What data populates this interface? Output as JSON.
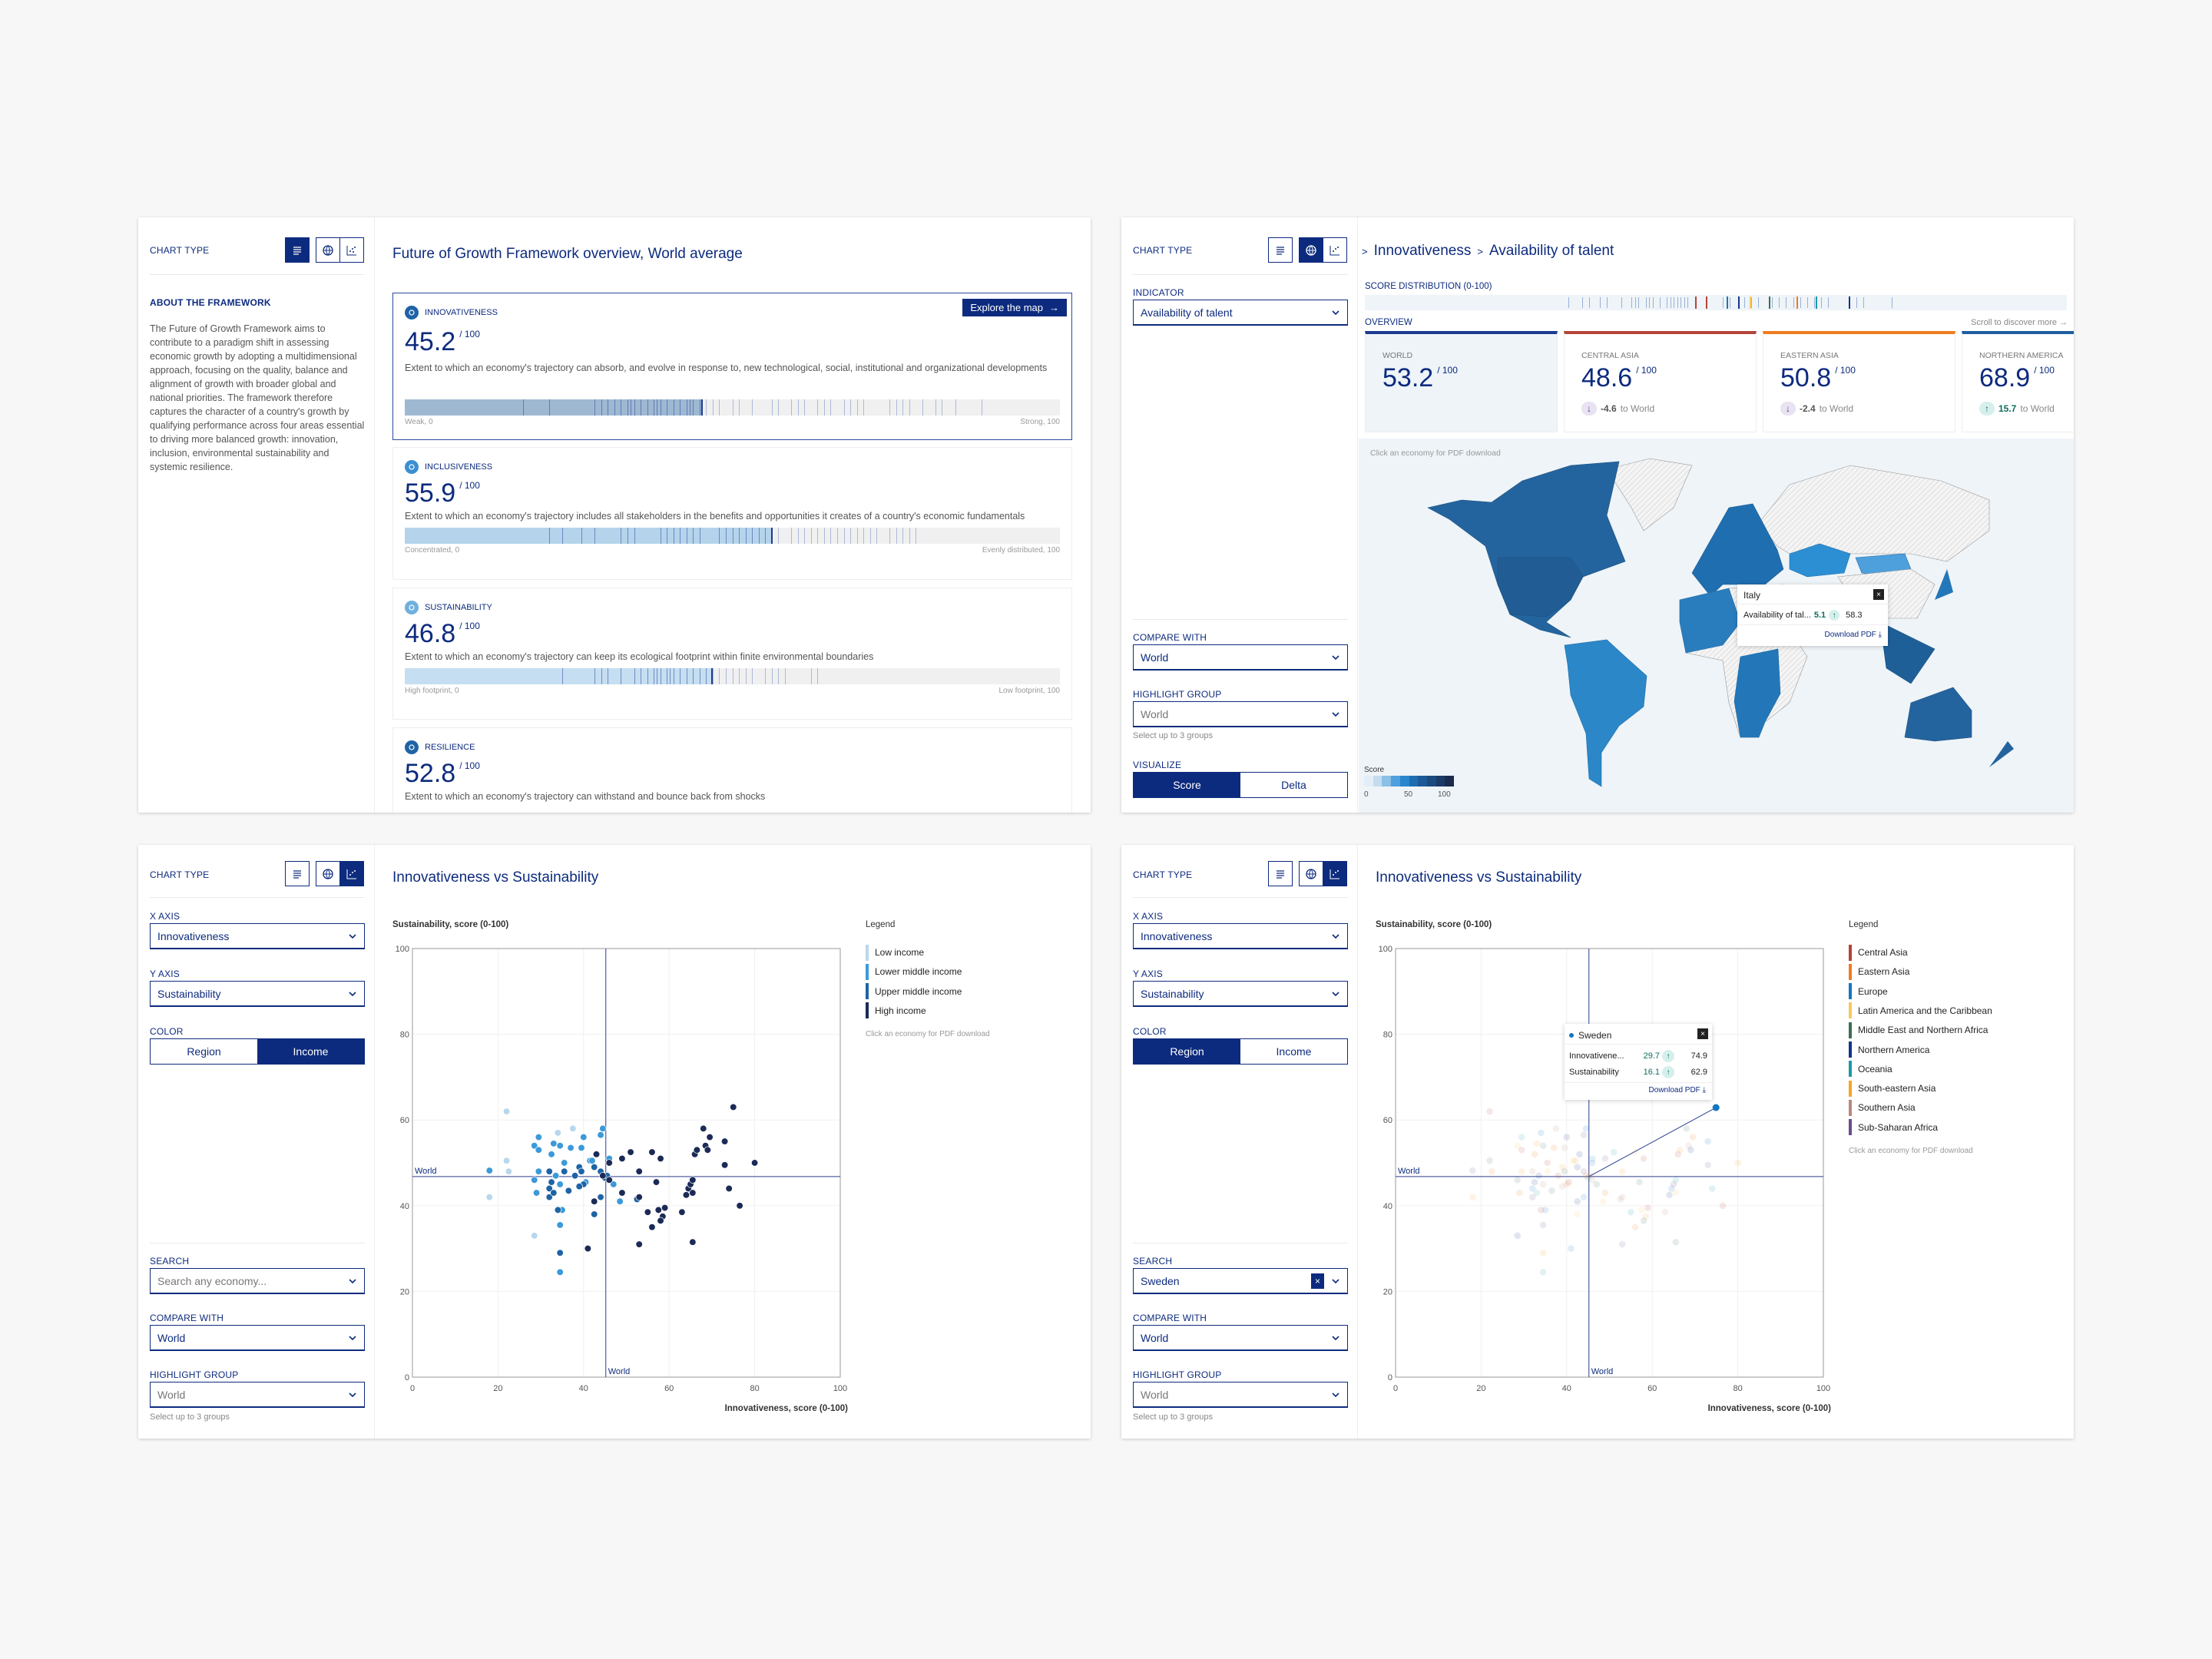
{
  "common": {
    "chart_type_label": "CHART TYPE",
    "per100": "/ 100",
    "compare_with_label": "COMPARE WITH",
    "compare_with_value": "World",
    "highlight_group_label": "HIGHLIGHT GROUP",
    "highlight_group_value": "World",
    "highlight_hint": "Select up to 3 groups",
    "click_hint": "Click an economy for PDF download"
  },
  "overview_panel": {
    "about_label": "ABOUT THE FRAMEWORK",
    "about_text": "The Future of Growth Framework aims to contribute to a paradigm shift in assessing economic growth by adopting a multidimensional approach, focusing on the quality, balance and alignment of growth with broader global and national priorities. The framework therefore captures the character of a country's growth by qualifying performance across four areas essential to driving more balanced growth: innovation, inclusion, environmental sustainability and systemic resilience.",
    "title": "Future of Growth Framework overview, World average",
    "explore_button": "Explore the map",
    "pillars": [
      {
        "name": "INNOVATIVENESS",
        "score": "45.2",
        "value": 45.2,
        "icon": "lightbulb-icon",
        "color": "#1e64a5",
        "fill": "#9fb8d2",
        "desc": "Extent to which an economy's trajectory can absorb, and evolve in response to, new technological, social, institutional and organizational developments",
        "low": "Weak, 0",
        "high": "Strong, 100",
        "ticks": [
          18,
          22,
          29,
          30,
          31,
          32,
          33,
          34,
          34.5,
          35,
          36,
          37,
          38,
          38.5,
          39,
          40,
          41,
          42,
          43,
          43.5,
          44,
          45,
          46,
          47,
          48,
          50,
          51,
          53,
          56,
          57,
          59,
          60,
          61,
          63,
          64,
          65,
          67,
          68,
          69,
          70,
          74,
          75,
          76,
          77,
          79,
          81,
          82,
          84,
          88
        ]
      },
      {
        "name": "INCLUSIVENESS",
        "score": "55.9",
        "value": 55.9,
        "icon": "network-icon",
        "color": "#3b8fd0",
        "fill": "#b5d4ec",
        "desc": "Extent to which an economy's trajectory includes all stakeholders in the benefits and opportunities it creates of a country's economic fundamentals",
        "low": "Concentrated, 0",
        "high": "Evenly distributed, 100",
        "ticks": [
          22,
          24,
          27,
          29,
          33,
          34,
          35,
          39,
          40,
          41,
          42,
          43,
          44,
          45,
          48,
          49,
          50,
          51,
          52,
          53,
          54,
          55,
          56,
          57,
          59,
          60,
          61,
          62,
          63,
          64,
          65,
          66,
          67,
          68,
          69,
          70,
          71,
          72,
          74,
          75,
          76,
          77,
          78
        ]
      },
      {
        "name": "SUSTAINABILITY",
        "score": "46.8",
        "value": 46.8,
        "icon": "globe-leaf-icon",
        "color": "#6fb0dd",
        "fill": "#c5def1",
        "desc": "Extent to which an economy's trajectory can keep its ecological footprint within finite environmental boundaries",
        "low": "High footprint, 0",
        "high": "Low footprint, 100",
        "ticks": [
          24,
          29,
          30,
          31,
          33,
          35,
          36,
          37,
          38,
          38.5,
          39,
          40,
          40.5,
          41,
          42,
          43,
          44,
          45,
          46,
          47,
          48,
          49,
          50,
          51,
          52,
          53,
          55,
          56,
          57,
          58,
          62,
          63
        ]
      },
      {
        "name": "RESILIENCE",
        "score": "52.8",
        "value": 52.8,
        "icon": "shield-arrows-icon",
        "color": "#1e64a5",
        "desc": "Extent to which an economy's trajectory can withstand and bounce back from shocks"
      }
    ]
  },
  "map_panel": {
    "breadcrumb": [
      "Innovativeness",
      "Availability of talent"
    ],
    "indicator_label": "INDICATOR",
    "indicator_value": "Availability of talent",
    "visualize_label": "VISUALIZE",
    "visualize_options": [
      "Score",
      "Delta"
    ],
    "visualize_selected": "Score",
    "distribution_label": "SCORE DISTRIBUTION (0-100)",
    "distribution_ticks": [
      29,
      31,
      32,
      33.5,
      34.5,
      36.5,
      38,
      38.5,
      39,
      40,
      40.5,
      41,
      42,
      43,
      43.5,
      44,
      44.5,
      45,
      45.5,
      46,
      51,
      52,
      54,
      55,
      56,
      58,
      59,
      60,
      61,
      62,
      63,
      64,
      65,
      66,
      69,
      70,
      71,
      75
    ],
    "distribution_highlights": [
      {
        "value": 47,
        "color": "#b5443a"
      },
      {
        "value": 48.6,
        "color": "#b5443a"
      },
      {
        "value": 51.5,
        "color": "#1277c2"
      },
      {
        "value": 53.2,
        "color": "#10358a"
      },
      {
        "value": 54.8,
        "color": "#f7c85c"
      },
      {
        "value": 57.5,
        "color": "#3f6e55"
      },
      {
        "value": 61.5,
        "color": "#f07c1e"
      },
      {
        "value": 64.2,
        "color": "#1b9aaa"
      },
      {
        "value": 68.9,
        "color": "#10358a"
      }
    ],
    "overview_label": "OVERVIEW",
    "scroll_hint": "Scroll to discover more →",
    "overview_cards": [
      {
        "name": "WORLD",
        "score": "53.2",
        "color": "#1d3b8f"
      },
      {
        "name": "CENTRAL ASIA",
        "score": "48.6",
        "color": "#b5443a",
        "delta": "-4.6",
        "direction": "down",
        "suffix": "to World"
      },
      {
        "name": "EASTERN ASIA",
        "score": "50.8",
        "color": "#f07c1e",
        "delta": "-2.4",
        "direction": "down",
        "suffix": "to World"
      },
      {
        "name": "NORTHERN AMERICA",
        "score": "68.9",
        "color": "#1f5fa0",
        "delta": "15.7",
        "direction": "up",
        "suffix": "to World"
      }
    ],
    "map_tooltip": {
      "country": "Italy",
      "indicator": "Availability of tal...",
      "delta": "5.1",
      "direction": "up",
      "value": "58.3",
      "download": "Download PDF"
    },
    "legend": {
      "title": "Score",
      "ticks": [
        "0",
        "50",
        "100"
      ],
      "colors": [
        "#e3eef8",
        "#c4dcef",
        "#8cc0e6",
        "#4ea0dc",
        "#2a86cc",
        "#1e6db1",
        "#1c5a97",
        "#1b4a7e",
        "#1b3a66",
        "#1a2b4e"
      ]
    }
  },
  "scatter_income_panel": {
    "title": "Innovativeness vs Sustainability",
    "x_axis_label": "X AXIS",
    "x_axis_value": "Innovativeness",
    "y_axis_label": "Y AXIS",
    "y_axis_value": "Sustainability",
    "color_label": "COLOR",
    "color_options": [
      "Region",
      "Income"
    ],
    "color_selected": "Income",
    "search_label": "SEARCH",
    "search_placeholder": "Search any economy...",
    "legend_title": "Legend"
  },
  "scatter_region_panel": {
    "title": "Innovativeness vs Sustainability",
    "x_axis_label": "X AXIS",
    "x_axis_value": "Innovativeness",
    "y_axis_label": "Y AXIS",
    "y_axis_value": "Sustainability",
    "color_label": "COLOR",
    "color_options": [
      "Region",
      "Income"
    ],
    "color_selected": "Region",
    "search_label": "SEARCH",
    "search_value": "Sweden",
    "legend_title": "Legend",
    "tooltip": {
      "country": "Sweden",
      "rows": [
        {
          "label": "Innovativene...",
          "delta": "29.7",
          "direction": "up",
          "value": "74.9"
        },
        {
          "label": "Sustainability",
          "delta": "16.1",
          "direction": "up",
          "value": "62.9"
        }
      ],
      "download": "Download PDF"
    }
  },
  "chart_data": [
    {
      "type": "scatter",
      "title": "Innovativeness vs Sustainability",
      "xlabel": "Innovativeness, score (0-100)",
      "ylabel": "Sustainability, score (0-100)",
      "xlim": [
        0,
        100
      ],
      "ylim": [
        0,
        100
      ],
      "xticks": [
        "0",
        "20",
        "40",
        "60",
        "80",
        "100"
      ],
      "yticks": [
        "0",
        "20",
        "40",
        "60",
        "80",
        "100"
      ],
      "grid": true,
      "legend_position": "right",
      "reference_lines": {
        "x": 45.2,
        "y": 46.8,
        "label": "World"
      },
      "series": [
        {
          "name": "Low income",
          "color": "#b9d7ec",
          "points": [
            [
              22,
              62
            ],
            [
              18,
              42
            ],
            [
              22,
              50.5
            ],
            [
              22.5,
              48
            ],
            [
              37.5,
              58
            ],
            [
              28.5,
              33
            ],
            [
              34,
              57
            ]
          ]
        },
        {
          "name": "Lower middle income",
          "color": "#3b9ad9",
          "points": [
            [
              18,
              48.2
            ],
            [
              29.5,
              56
            ],
            [
              28.5,
              54
            ],
            [
              29.5,
              53
            ],
            [
              33,
              54.5
            ],
            [
              34.5,
              54
            ],
            [
              37,
              53.5
            ],
            [
              39.5,
              53.5
            ],
            [
              40,
              56
            ],
            [
              44.5,
              58
            ],
            [
              44,
              56.5
            ],
            [
              46,
              51
            ],
            [
              41.5,
              50.5
            ],
            [
              35.5,
              50
            ],
            [
              29.5,
              48
            ],
            [
              28.5,
              46
            ],
            [
              29,
              43
            ],
            [
              34.5,
              45
            ],
            [
              33.5,
              47
            ],
            [
              35,
              39
            ],
            [
              34.5,
              35.5
            ],
            [
              34.5,
              24.5
            ],
            [
              48.5,
              41
            ],
            [
              40.5,
              45.5
            ],
            [
              42,
              50.5
            ],
            [
              47,
              45
            ],
            [
              32.5,
              52
            ]
          ]
        },
        {
          "name": "Upper middle income",
          "color": "#1e64a5",
          "points": [
            [
              32,
              48
            ],
            [
              32.5,
              45.5
            ],
            [
              32,
              44
            ],
            [
              32,
              42
            ],
            [
              33,
              43
            ],
            [
              35.5,
              48
            ],
            [
              38,
              47
            ],
            [
              39,
              49
            ],
            [
              39.5,
              48
            ],
            [
              40,
              45
            ],
            [
              39,
              44.5
            ],
            [
              42.5,
              49
            ],
            [
              44,
              42
            ],
            [
              44,
              48
            ],
            [
              45,
              46.5
            ],
            [
              42.5,
              38
            ],
            [
              34,
              39
            ],
            [
              34.5,
              29
            ],
            [
              36.5,
              43.5
            ],
            [
              45.5,
              47
            ],
            [
              52.5,
              41.5
            ]
          ]
        },
        {
          "name": "High income",
          "color": "#1b2a56",
          "points": [
            [
              43,
              52
            ],
            [
              46,
              50
            ],
            [
              49,
              51
            ],
            [
              51,
              52.5
            ],
            [
              56,
              52.5
            ],
            [
              58,
              51
            ],
            [
              53,
              48
            ],
            [
              57,
              45.5
            ],
            [
              49,
              43
            ],
            [
              53,
              42
            ],
            [
              42.5,
              41
            ],
            [
              41,
              30
            ],
            [
              53,
              31
            ],
            [
              55,
              38.5
            ],
            [
              57.5,
              39
            ],
            [
              59,
              39.5
            ],
            [
              58.5,
              37.5
            ],
            [
              58,
              36.5
            ],
            [
              56,
              35
            ],
            [
              63,
              38.5
            ],
            [
              64,
              42.5
            ],
            [
              64.5,
              44
            ],
            [
              65,
              45
            ],
            [
              65.5,
              46
            ],
            [
              65.5,
              43
            ],
            [
              66,
              52
            ],
            [
              66.5,
              53
            ],
            [
              68,
              58
            ],
            [
              69.5,
              56
            ],
            [
              68.5,
              54
            ],
            [
              69,
              53
            ],
            [
              73,
              55
            ],
            [
              73,
              49.5
            ],
            [
              74,
              44
            ],
            [
              75,
              63
            ],
            [
              76.5,
              40
            ],
            [
              80,
              50
            ],
            [
              65.5,
              31.5
            ],
            [
              44.5,
              47
            ],
            [
              46,
              46
            ]
          ]
        }
      ]
    },
    {
      "type": "scatter",
      "title": "Innovativeness vs Sustainability",
      "xlabel": "Innovativeness, score (0-100)",
      "ylabel": "Sustainability, score (0-100)",
      "xlim": [
        0,
        100
      ],
      "ylim": [
        0,
        100
      ],
      "xticks": [
        "0",
        "20",
        "40",
        "60",
        "80",
        "100"
      ],
      "yticks": [
        "0",
        "20",
        "40",
        "60",
        "80",
        "100"
      ],
      "grid": true,
      "legend_position": "right",
      "reference_lines": {
        "x": 45.2,
        "y": 46.8,
        "label": "World"
      },
      "highlighted": {
        "name": "Sweden",
        "x": 74.9,
        "y": 62.9,
        "color": "#1277c2"
      },
      "legend": [
        {
          "name": "Central Asia",
          "color": "#b5443a"
        },
        {
          "name": "Eastern Asia",
          "color": "#f07c1e"
        },
        {
          "name": "Europe",
          "color": "#1277c2"
        },
        {
          "name": "Latin America and the Caribbean",
          "color": "#f7c85c"
        },
        {
          "name": "Middle East and Northern Africa",
          "color": "#3f6e55"
        },
        {
          "name": "Northern America",
          "color": "#10358a"
        },
        {
          "name": "Oceania",
          "color": "#1b9aaa"
        },
        {
          "name": "South-eastern Asia",
          "color": "#f5a623"
        },
        {
          "name": "Southern Asia",
          "color": "#b9887f"
        },
        {
          "name": "Sub-Saharan Africa",
          "color": "#6a4c8c"
        }
      ]
    }
  ]
}
